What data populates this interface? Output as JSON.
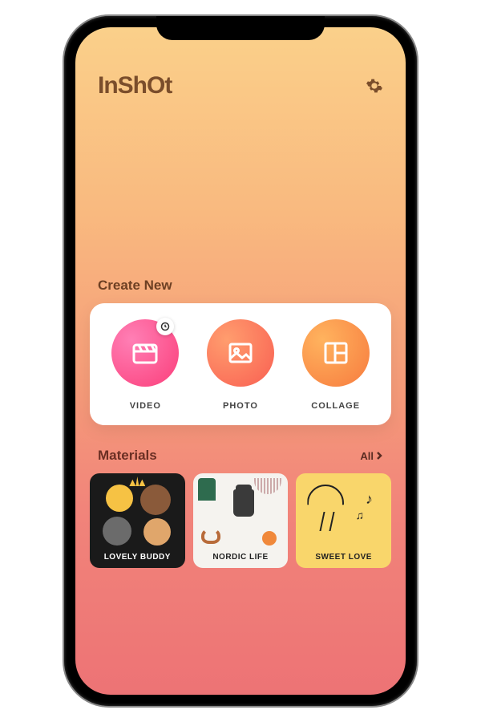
{
  "header": {
    "logo": "InShOt",
    "settings_icon": "gear-icon"
  },
  "create": {
    "section_label": "Create New",
    "items": [
      {
        "label": "VIDEO",
        "icon": "clapperboard-icon",
        "badge": "clock-icon"
      },
      {
        "label": "PHOTO",
        "icon": "image-icon"
      },
      {
        "label": "COLLAGE",
        "icon": "grid-icon"
      }
    ]
  },
  "materials": {
    "section_label": "Materials",
    "all_label": "All",
    "items": [
      {
        "label": "LOVELY BUDDY",
        "theme": "dark"
      },
      {
        "label": "NORDIC LIFE",
        "theme": "light"
      },
      {
        "label": "SWEET LOVE",
        "theme": "yellow"
      }
    ]
  },
  "colors": {
    "gradient_top": "#fad08a",
    "gradient_bottom": "#ed7375",
    "video_accent": "#fb3e7a",
    "photo_accent": "#f95f52",
    "collage_accent": "#f77b3e"
  }
}
